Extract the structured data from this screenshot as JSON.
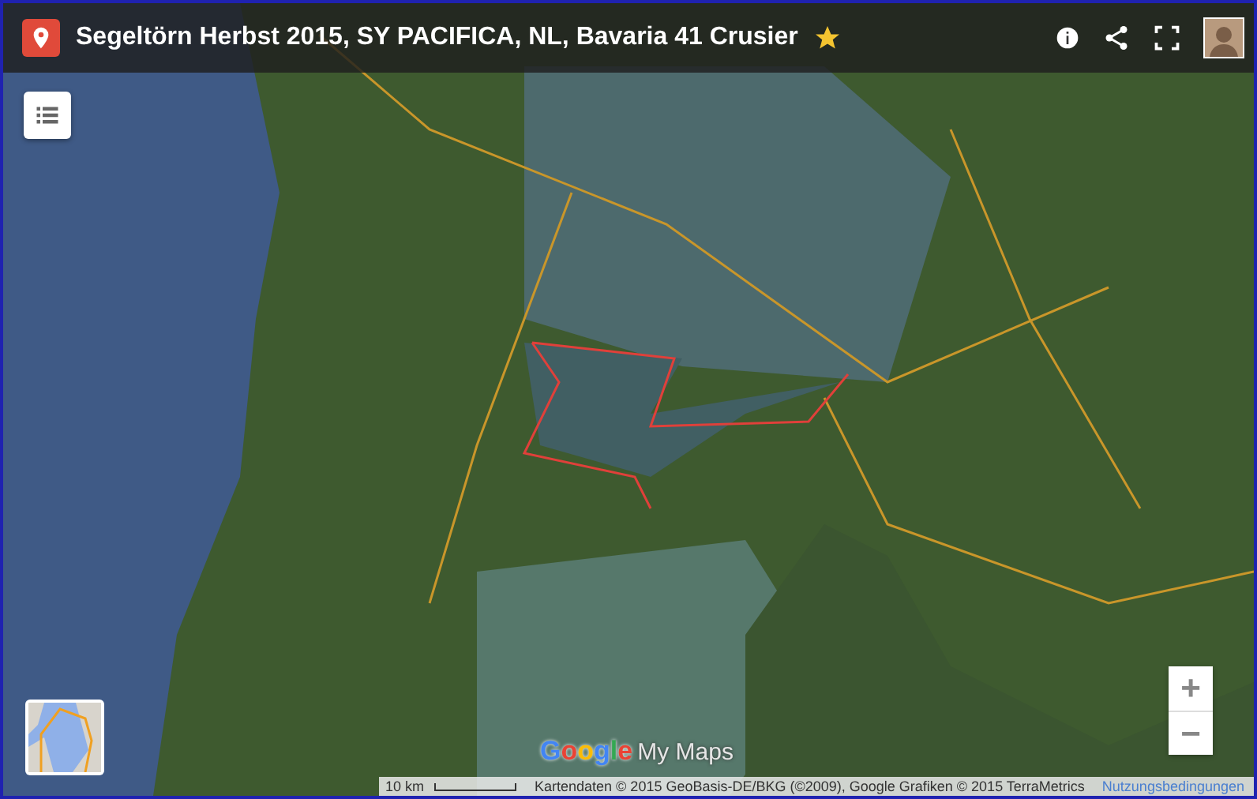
{
  "header": {
    "title": "Segeltörn Herbst 2015, SY PACIFICA, NL, Bavaria 41 Crusier"
  },
  "logo": {
    "brand": "Google",
    "product": "My Maps"
  },
  "zoom_controls": [
    "+",
    "−"
  ],
  "footer": {
    "scale": "10 km",
    "attribution": "Kartendaten © 2015 GeoBasis-DE/BKG (©2009), Google Grafiken © 2015 TerraMetrics",
    "terms_link": "Nutzungsbedingungen"
  }
}
